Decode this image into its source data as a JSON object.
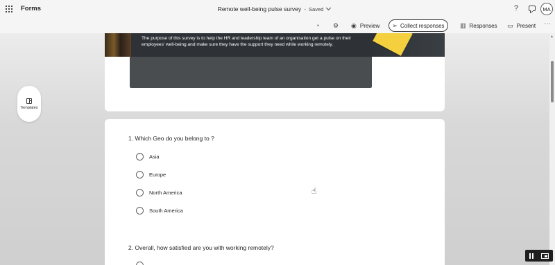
{
  "app": {
    "name": "Forms"
  },
  "document": {
    "title": "Remote well-being pulse survey",
    "separator": "-",
    "status": "Saved"
  },
  "header_right": {
    "help": "?",
    "avatar_initials": "MA"
  },
  "toolbar": {
    "preview_label": "Preview",
    "collect_label": "Collect responses",
    "responses_label": "Responses",
    "present_label": "Present",
    "more": "···"
  },
  "sidebar": {
    "templates_label": "Templates"
  },
  "form": {
    "description": "The purpose of this survey is to help the HR and leadership team of an organisation get a pulse on their employees' well-being and make sure they have the support they need while working remotely.",
    "questions": [
      {
        "title": "1. Which Geo do you belong to ?",
        "options": [
          "Asia",
          "Europe",
          "North America",
          "South America"
        ]
      },
      {
        "title": "2. Overall, how satisfied are you with working remotely?",
        "options": []
      }
    ]
  },
  "colors": {
    "accent": "#242424",
    "banner": "#2e3236",
    "sticky_note": "#f4d03f",
    "card": "#ffffff"
  }
}
